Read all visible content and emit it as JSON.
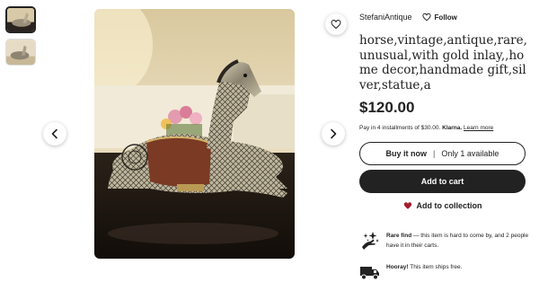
{
  "shop": {
    "name": "StefaniAntique",
    "follow_label": "Follow"
  },
  "listing": {
    "title": "horse,vintage,antique,rare,unusual,with gold inlay,,home decor,handmade gift,silver,statue,a",
    "price": "$120.00",
    "klarna": {
      "prefix": "Pay in 4 installments of $30.00.",
      "brand": "Klarna.",
      "learn_more": "Learn more"
    }
  },
  "actions": {
    "buy_now": "Buy it now",
    "separator": "|",
    "availability": "Only 1 available",
    "add_to_cart": "Add to cart",
    "add_to_collection": "Add to collection"
  },
  "highlights": {
    "rare": {
      "bold": "Rare find",
      "text": " — this item is hard to come by, and 2 people have it in their carts."
    },
    "shipping": {
      "bold": "Hooray!",
      "text": " This item ships free."
    }
  },
  "icons": {
    "prev": "chevron-left-icon",
    "next": "chevron-right-icon",
    "favorite": "heart-outline-icon",
    "follow": "heart-outline-icon",
    "collection": "heart-filled-icon",
    "rare": "sparkle-hand-icon",
    "shipping": "truck-icon"
  },
  "colors": {
    "primary": "#222222",
    "collection_heart": "#a61a2e",
    "page_bg": "#ffffff"
  }
}
